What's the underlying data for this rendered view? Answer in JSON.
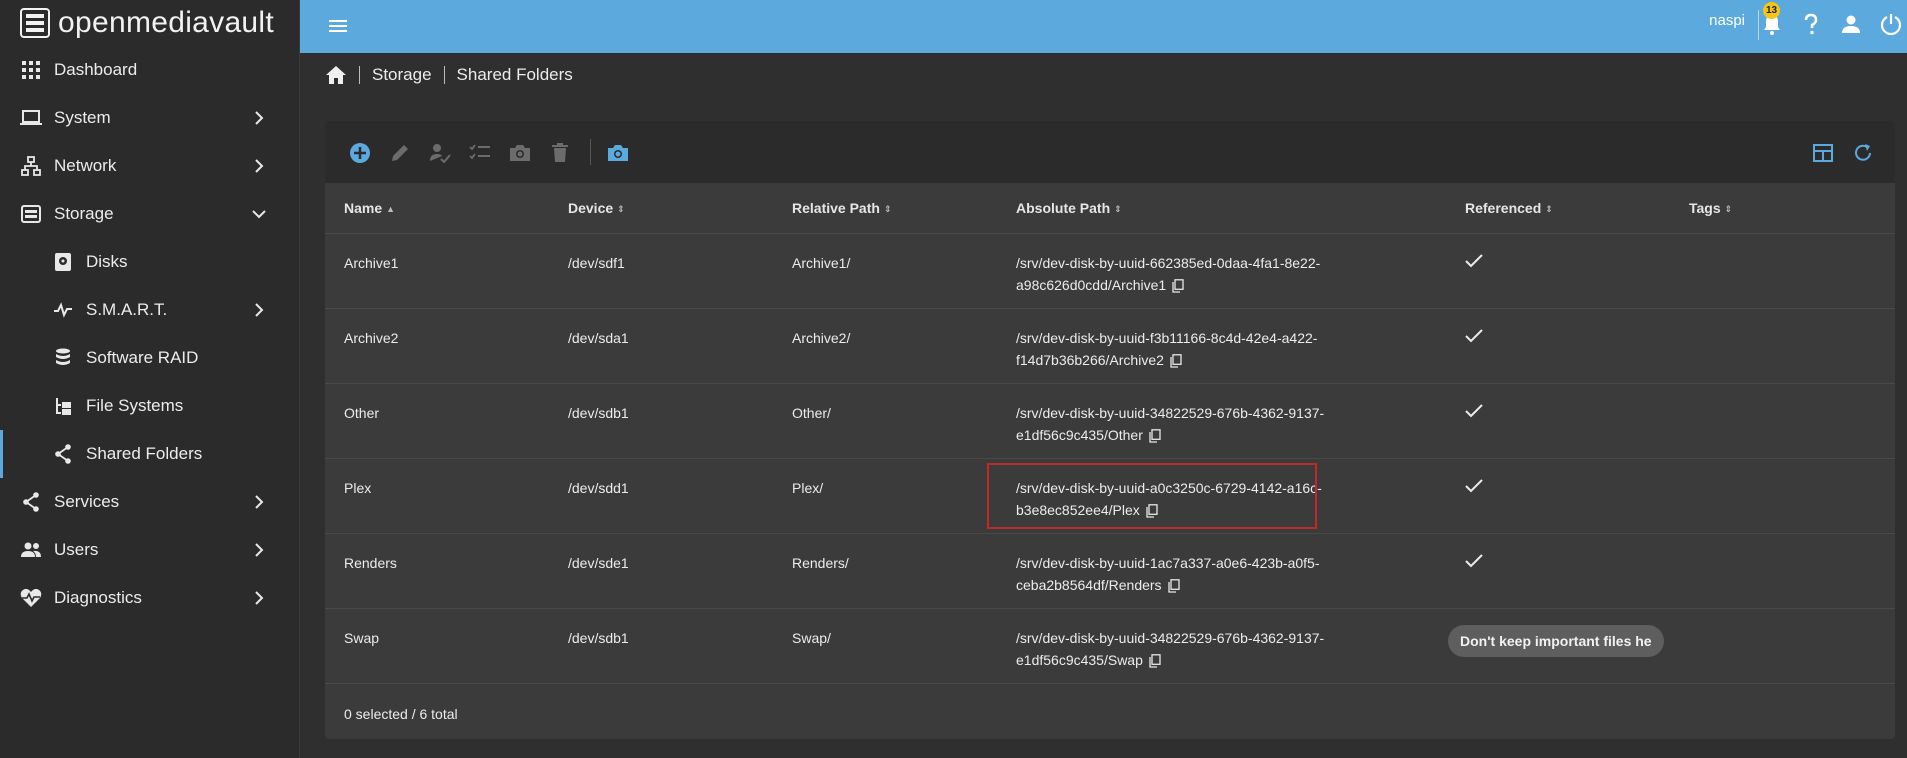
{
  "app": {
    "brand": "openmediavault"
  },
  "sidebar": {
    "items": [
      {
        "label": "Dashboard",
        "icon": "dashboard-grid-icon"
      },
      {
        "label": "System",
        "icon": "laptop-icon"
      },
      {
        "label": "Network",
        "icon": "network-icon"
      },
      {
        "label": "Storage",
        "icon": "storage-icon"
      },
      {
        "label": "Disks",
        "icon": "disk-icon"
      },
      {
        "label": "S.M.A.R.T.",
        "icon": "pulse-icon"
      },
      {
        "label": "Software RAID",
        "icon": "database-icon"
      },
      {
        "label": "File Systems",
        "icon": "file-tree-icon"
      },
      {
        "label": "Shared Folders",
        "icon": "share-icon"
      },
      {
        "label": "Services",
        "icon": "share-icon"
      },
      {
        "label": "Users",
        "icon": "users-icon"
      },
      {
        "label": "Diagnostics",
        "icon": "heart-pulse-icon"
      }
    ]
  },
  "topbar": {
    "username": "naspi",
    "notification_count": "13"
  },
  "breadcrumb": {
    "level1": "Storage",
    "level2": "Shared Folders"
  },
  "table": {
    "columns": [
      "Name",
      "Device",
      "Relative Path",
      "Absolute Path",
      "Referenced",
      "Tags"
    ],
    "rows": [
      {
        "name": "Archive1",
        "device": "/dev/sdf1",
        "rel": "Archive1/",
        "abs1": "/srv/dev-disk-by-uuid-662385ed-0daa-4fa1-8e22-",
        "abs2": "a98c626d0cdd/Archive1"
      },
      {
        "name": "Archive2",
        "device": "/dev/sda1",
        "rel": "Archive2/",
        "abs1": "/srv/dev-disk-by-uuid-f3b11166-8c4d-42e4-a422-",
        "abs2": "f14d7b36b266/Archive2"
      },
      {
        "name": "Other",
        "device": "/dev/sdb1",
        "rel": "Other/",
        "abs1": "/srv/dev-disk-by-uuid-34822529-676b-4362-9137-",
        "abs2": "e1df56c9c435/Other"
      },
      {
        "name": "Plex",
        "device": "/dev/sdd1",
        "rel": "Plex/",
        "abs1": "/srv/dev-disk-by-uuid-a0c3250c-6729-4142-a16c-",
        "abs2": "b3e8ec852ee4/Plex"
      },
      {
        "name": "Renders",
        "device": "/dev/sde1",
        "rel": "Renders/",
        "abs1": "/srv/dev-disk-by-uuid-1ac7a337-a0e6-423b-a0f5-",
        "abs2": "ceba2b8564df/Renders"
      },
      {
        "name": "Swap",
        "device": "/dev/sdb1",
        "rel": "Swap/",
        "abs1": "/srv/dev-disk-by-uuid-34822529-676b-4362-9137-",
        "abs2": "e1df56c9c435/Swap"
      }
    ],
    "swap_tag": "Don't keep important files he",
    "footer": "0 selected / 6 total"
  },
  "colors": {
    "accent": "#5ca9dd",
    "highlight": "#c12a2a",
    "badge": "#f5c518"
  }
}
